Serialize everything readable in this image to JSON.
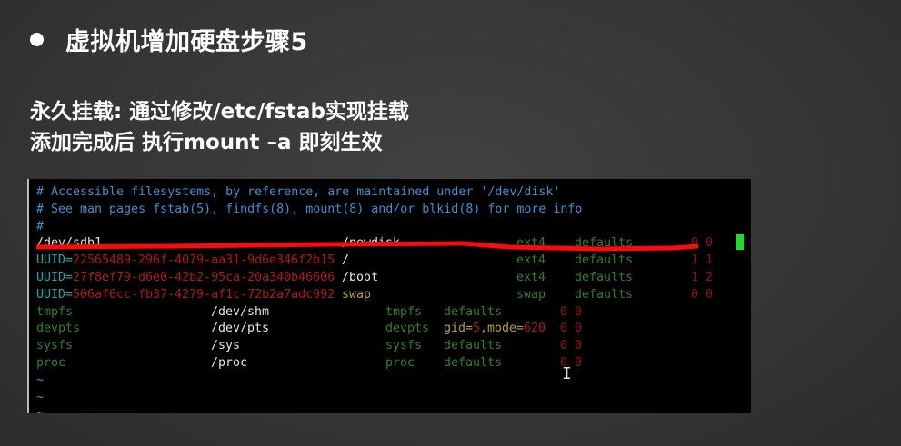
{
  "slide": {
    "title": "虚拟机增加硬盘步骤5",
    "line1": "永久挂载: 通过修改/etc/fstab实现挂载",
    "line2": "添加完成后 执行mount   –a 即刻生效"
  },
  "terminal": {
    "lines": [
      [
        [
          "# Accessible filesystems, by reference, are maintained under '/dev/disk'",
          "comment",
          0
        ]
      ],
      [
        [
          "# See man pages fstab(5), findfs(8), mount(8) and/or blkid(8) for more info",
          "comment",
          0
        ]
      ],
      [
        [
          "#",
          "comment",
          0
        ]
      ],
      [
        [
          "/dev/sdb1",
          "white",
          0
        ],
        [
          "/newdisk",
          "white",
          42
        ],
        [
          "ext4",
          "green",
          66
        ],
        [
          "defaults",
          "green",
          74
        ],
        [
          "0 0",
          "num",
          90
        ]
      ],
      [
        [
          "UUID=",
          "cyan",
          0
        ],
        [
          "22565489-296f-4079-aa31-9d6e346f2b15",
          "red",
          5
        ],
        [
          "/",
          "white",
          42
        ],
        [
          "ext4",
          "green",
          66
        ],
        [
          "defaults",
          "green",
          74
        ],
        [
          "1 1",
          "num",
          90
        ]
      ],
      [
        [
          "UUID=",
          "cyan",
          0
        ],
        [
          "27f8ef79-d6e0-42b2-95ca-20a340b46606",
          "red",
          5
        ],
        [
          "/boot",
          "white",
          42
        ],
        [
          "ext4",
          "green",
          66
        ],
        [
          "defaults",
          "green",
          74
        ],
        [
          "1 2",
          "num",
          90
        ]
      ],
      [
        [
          "UUID=",
          "cyan",
          0
        ],
        [
          "506af6cc-fb37-4279-af1c-72b2a7adc992",
          "red",
          5
        ],
        [
          "swap",
          "yellow",
          42
        ],
        [
          "swap",
          "green",
          66
        ],
        [
          "defaults",
          "green",
          74
        ],
        [
          "0 0",
          "num",
          90
        ]
      ],
      [
        [
          "tmpfs",
          "green",
          0
        ],
        [
          "/dev/shm",
          "white",
          24
        ],
        [
          "tmpfs",
          "green",
          48
        ],
        [
          "defaults",
          "green",
          56
        ],
        [
          "0 0",
          "num",
          72
        ]
      ],
      [
        [
          "devpts",
          "green",
          0
        ],
        [
          "/dev/pts",
          "white",
          24
        ],
        [
          "devpts",
          "green",
          48
        ],
        [
          "gid=",
          "yellow",
          56
        ],
        [
          "5",
          "red",
          60
        ],
        [
          ",mode=",
          "yellow",
          61
        ],
        [
          "620",
          "red",
          67
        ],
        [
          "0 0",
          "num",
          72
        ]
      ],
      [
        [
          "sysfs",
          "green",
          0
        ],
        [
          "/sys",
          "white",
          24
        ],
        [
          "sysfs",
          "green",
          48
        ],
        [
          "defaults",
          "green",
          56
        ],
        [
          "0 0",
          "num",
          72
        ]
      ],
      [
        [
          "proc",
          "green",
          0
        ],
        [
          "/proc",
          "white",
          24
        ],
        [
          "proc",
          "green",
          48
        ],
        [
          "defaults",
          "green",
          56
        ],
        [
          "0 0",
          "num",
          72
        ]
      ],
      [
        [
          "~",
          "tilde",
          0
        ]
      ],
      [
        [
          "~",
          "tilde",
          0
        ]
      ],
      [
        [
          "~",
          "tilde",
          0
        ]
      ]
    ]
  }
}
